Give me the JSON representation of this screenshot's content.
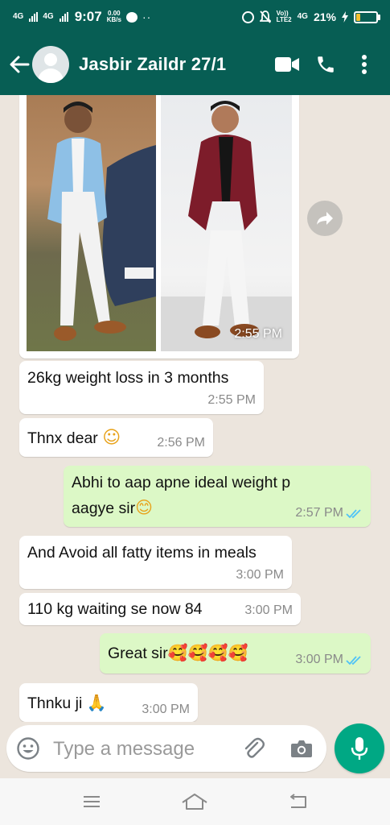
{
  "status_bar": {
    "signal1": "4G",
    "signal2": "4G",
    "time": "9:07",
    "net_speed_value": "0.00",
    "net_speed_unit": "KB/s",
    "volte_top": "Vo))",
    "volte_bottom": "LTE2",
    "net_type": "4G",
    "battery_percent": "21%",
    "battery_level": 0.21,
    "battery_color": "#f6c030"
  },
  "header": {
    "contact_name": "Jasbir Zaildr 27/1",
    "bg_color": "#075e54",
    "icons": [
      "back-arrow-icon",
      "avatar",
      "video-call-icon",
      "voice-call-icon",
      "more-vert-icon"
    ]
  },
  "messages": [
    {
      "type": "image",
      "direction": "in",
      "time": "2:55 PM",
      "images": [
        "person-in-blue-blazer",
        "person-in-maroon-jacket"
      ]
    },
    {
      "type": "text",
      "direction": "in",
      "text": "26kg weight loss in 3 months",
      "time": "2:55 PM"
    },
    {
      "type": "text",
      "direction": "in",
      "text": "Thnx dear",
      "emoji": "☺",
      "time": "2:56 PM"
    },
    {
      "type": "text",
      "direction": "out",
      "line1": "Abhi to aap apne ideal weight p",
      "line2": "aagye sir",
      "emoji": "😊",
      "time": "2:57 PM",
      "status": "read"
    },
    {
      "type": "text",
      "direction": "in",
      "text": "And Avoid all fatty items in meals",
      "time": "3:00 PM"
    },
    {
      "type": "text",
      "direction": "in",
      "text": "110 kg waiting se now 84",
      "time": "3:00 PM"
    },
    {
      "type": "text",
      "direction": "out",
      "text": "Great sir",
      "emoji": "🥰🥰🥰🥰",
      "time": "3:00 PM",
      "status": "read"
    },
    {
      "type": "text",
      "direction": "in",
      "text": "Thnku ji",
      "emoji": "🙏",
      "time": "3:00 PM"
    }
  ],
  "composer": {
    "placeholder": "Type a message",
    "icons": [
      "emoji-icon",
      "attach-icon",
      "camera-icon",
      "mic-icon"
    ]
  },
  "colors": {
    "chat_bg": "#ece5dd",
    "outgoing_bubble": "#dcf8c6",
    "incoming_bubble": "#ffffff",
    "read_tick": "#4fc3f7",
    "mic_button": "#00a884"
  }
}
